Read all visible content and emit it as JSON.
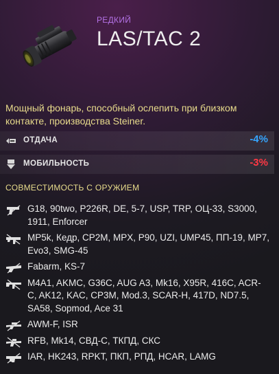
{
  "item": {
    "rarity": "РЕДКИЙ",
    "name": "LAS/TAC 2",
    "icon": "flashlight-icon",
    "description": "Мощный фонарь, способный ослепить при близком контакте, производства Steiner."
  },
  "stats": [
    {
      "icon": "recoil-icon",
      "label": "ОТДАЧА",
      "value": "-4%",
      "color": "#35a5ff"
    },
    {
      "icon": "mobility-icon",
      "label": "МОБИЛЬНОСТЬ",
      "value": "-3%",
      "color": "#ff3844"
    }
  ],
  "compatibility": {
    "heading": "СОВМЕСТИМОСТЬ С ОРУЖИЕМ",
    "groups": [
      {
        "icon": "pistol-icon",
        "weapons": "G18, 90two, P226R, DE, 5-7, USP, TRP, ОЦ-33, S3000, 1911, Enforcer"
      },
      {
        "icon": "smg-icon",
        "weapons": "MP5k, Кедр, CP2M, MPX, P90, UZI, UMP45, ПП-19, MP7, Evo3, SMG-45"
      },
      {
        "icon": "shotgun-icon",
        "weapons": "Fabarm, KS-7"
      },
      {
        "icon": "assault-rifle-icon",
        "weapons": "M4A1, AKMC, G36C, AUG A3, Mk16, X95R, 416C, ACR-C, AK12, KAC, CP3M, Mod.3, SCAR-H, 417D, ND7.5, SA58, Sopmod, Ace 31"
      },
      {
        "icon": "sniper-rifle-icon",
        "weapons": "AWM-F, ISR"
      },
      {
        "icon": "marksman-rifle-icon",
        "weapons": "RFB, Mk14, СВД-С, ТКПД, СКС"
      },
      {
        "icon": "lmg-icon",
        "weapons": "IAR, HK243, RPKT, ПКП, РПД, HCAR, LAMG"
      }
    ]
  }
}
